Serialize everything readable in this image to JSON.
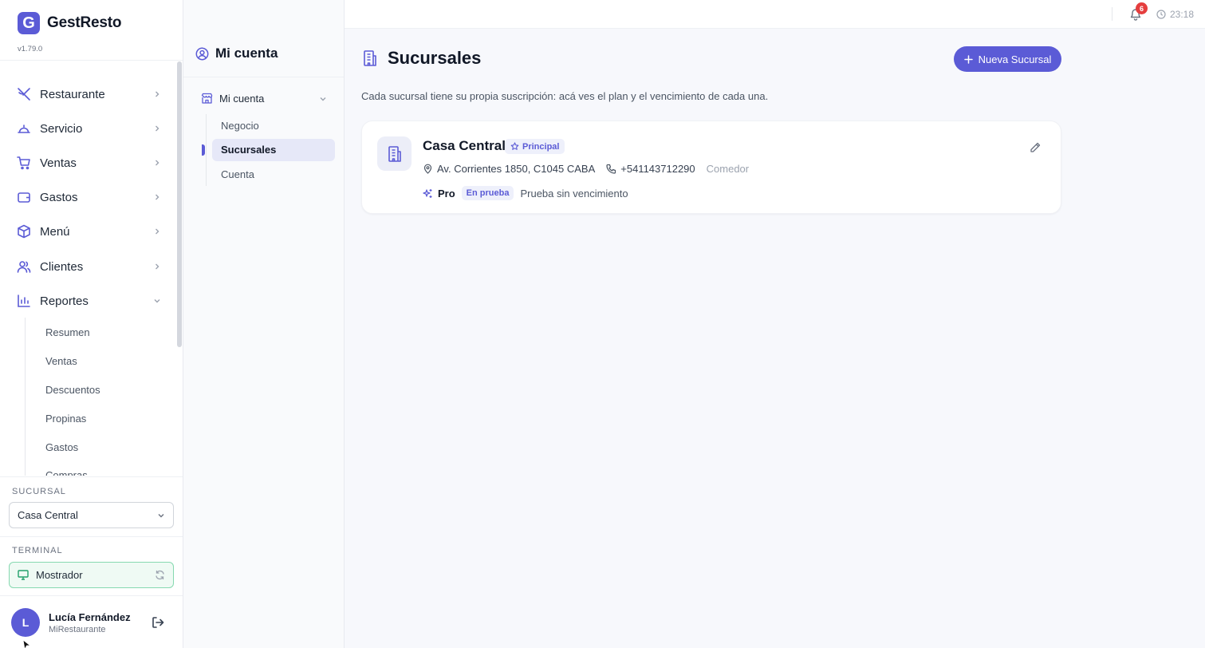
{
  "sidebar": {
    "brand": "GestResto",
    "logo_letter": "G",
    "version": "v1.79.0",
    "nav": [
      {
        "label": "Restaurante",
        "icon": "utensils-icon"
      },
      {
        "label": "Servicio",
        "icon": "room-service-icon"
      },
      {
        "label": "Ventas",
        "icon": "cart-icon"
      },
      {
        "label": "Gastos",
        "icon": "wallet-icon"
      },
      {
        "label": "Menú",
        "icon": "box-icon"
      },
      {
        "label": "Clientes",
        "icon": "users-icon"
      },
      {
        "label": "Reportes",
        "icon": "bar-chart-icon"
      }
    ],
    "reportes_sub": [
      "Resumen",
      "Ventas",
      "Descuentos",
      "Propinas",
      "Gastos",
      "Compras"
    ],
    "sucursal_label": "SUCURSAL",
    "sucursal_value": "Casa Central",
    "terminal_label": "TERMINAL",
    "terminal_value": "Mostrador",
    "user_initial": "L",
    "user_name": "Lucía Fernández",
    "user_business": "MiRestaurante"
  },
  "panel": {
    "title": "Mi cuenta",
    "group": "Mi cuenta",
    "items": [
      "Negocio",
      "Sucursales",
      "Cuenta"
    ],
    "active": "Sucursales"
  },
  "topbar": {
    "notifications": "6",
    "time": "23:18"
  },
  "main": {
    "title": "Sucursales",
    "new_button": "Nueva Sucursal",
    "description": "Cada sucursal tiene su propia suscripción: acá ves el plan y el vencimiento de cada una.",
    "branch": {
      "name": "Casa Central",
      "badge": "Principal",
      "address": "Av. Corrientes 1850, C1045 CABA",
      "phone": "+541143712290",
      "type": "Comedor",
      "plan": "Pro",
      "status": "En prueba",
      "expiry": "Prueba sin vencimiento"
    }
  },
  "colors": {
    "accent": "#5b5bd6",
    "badge_red": "#e53e3e",
    "terminal_green": "#86d9b0"
  }
}
